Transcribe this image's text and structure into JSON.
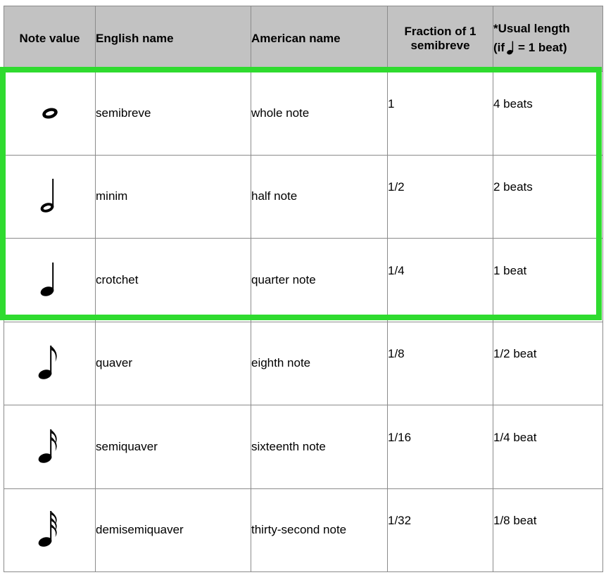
{
  "table": {
    "columns": [
      {
        "key": "note_value",
        "label": "Note value",
        "align": "center"
      },
      {
        "key": "english",
        "label": "English name",
        "align": "left"
      },
      {
        "key": "american",
        "label": "American name",
        "align": "left"
      },
      {
        "key": "fraction",
        "label": "Fraction of 1 semibreve",
        "align": "center"
      },
      {
        "key": "length",
        "label": "*Usual length",
        "align": "left"
      }
    ],
    "header_extra": {
      "fraction_line1": "Fraction of 1",
      "fraction_line2": "semibreve",
      "length_line1": "*Usual length",
      "length_line2_pre": "(if",
      "length_line2_glyph": "crotchet-note-icon",
      "length_line2_post": "= 1 beat)"
    },
    "rows": [
      {
        "glyph": "semibreve-note-icon",
        "english": "semibreve",
        "american": "whole note",
        "fraction": "1",
        "length": "4 beats",
        "highlighted": true
      },
      {
        "glyph": "minim-note-icon",
        "english": "minim",
        "american": "half note",
        "fraction": "1/2",
        "length": "2 beats",
        "highlighted": true
      },
      {
        "glyph": "crotchet-note-icon",
        "english": "crotchet",
        "american": "quarter note",
        "fraction": "1/4",
        "length": "1 beat",
        "highlighted": true
      },
      {
        "glyph": "quaver-note-icon",
        "english": "quaver",
        "american": "eighth note",
        "fraction": "1/8",
        "length": "1/2 beat",
        "highlighted": false
      },
      {
        "glyph": "semiquaver-note-icon",
        "english": "semiquaver",
        "american": "sixteenth note",
        "fraction": "1/16",
        "length": "1/4 beat",
        "highlighted": false
      },
      {
        "glyph": "demisemiquaver-note-icon",
        "english": "demisemiquaver",
        "american": "thirty-second note",
        "fraction": "1/32",
        "length": "1/8 beat",
        "highlighted": false
      }
    ]
  },
  "colors": {
    "header_background": "#c2c2c2",
    "highlight_border": "#2fdb2f",
    "grid_line": "#8b8b8b",
    "text": "#000000",
    "page_background": "#ffffff"
  }
}
